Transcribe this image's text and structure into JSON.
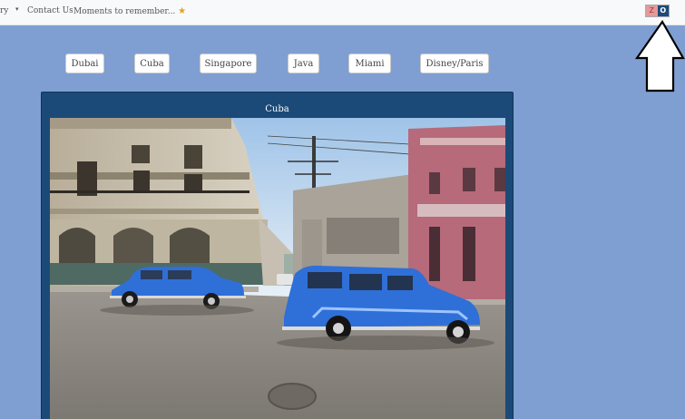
{
  "nav": {
    "gallery_label": "ry",
    "contact_label": "Contact Us",
    "moments_label": "Moments to remember...",
    "star_glyph": "★"
  },
  "lang_toggle": {
    "left": "Z",
    "right": "O"
  },
  "destinations": [
    "Dubai",
    "Cuba",
    "Singapore",
    "Java",
    "Miami",
    "Disney/Paris"
  ],
  "card": {
    "title": "Cuba"
  },
  "colors": {
    "page_bg": "#7f9fd2",
    "card_bg": "#1b4a78",
    "car_blue": "#2f6fd8"
  }
}
